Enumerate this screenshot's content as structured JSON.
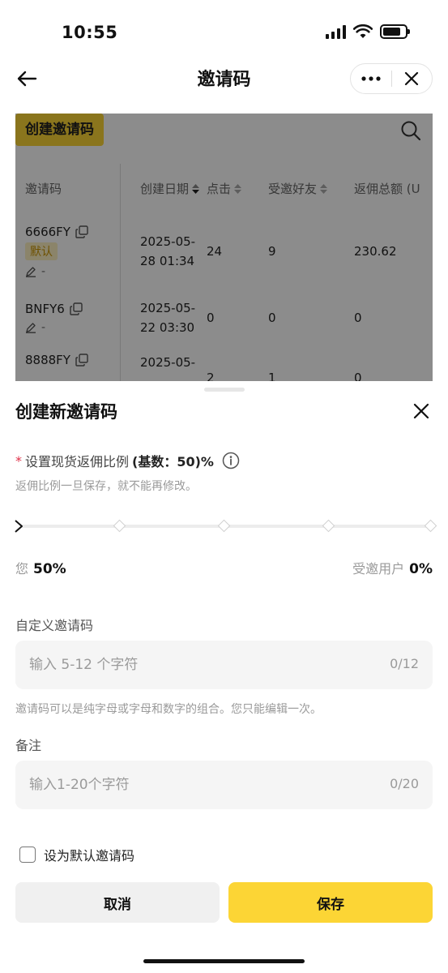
{
  "status_bar": {
    "time": "10:55"
  },
  "nav": {
    "title": "邀请码"
  },
  "background_page": {
    "create_button": "创建邀请码",
    "table": {
      "headers": [
        "邀请码",
        "创建日期",
        "点击",
        "受邀好友",
        "返佣总额 (U"
      ],
      "rows": [
        {
          "code": "6666FY",
          "badge": "默认",
          "note": "-",
          "date_line1": "2025-05-",
          "date_line2": "28 01:34",
          "clicks": "24",
          "friends": "9",
          "rebate": "230.62"
        },
        {
          "code": "BNFY6",
          "badge": "",
          "note": "-",
          "date_line1": "2025-05-",
          "date_line2": "22 03:30",
          "clicks": "0",
          "friends": "0",
          "rebate": "0"
        },
        {
          "code": "8888FY",
          "badge": "",
          "note": "",
          "date_line1": "2025-05-",
          "date_line2": "",
          "clicks": "2",
          "friends": "1",
          "rebate": "0"
        }
      ]
    }
  },
  "sheet": {
    "title": "创建新邀请码",
    "ratio_required_mark": "*",
    "ratio_label": "设置现货返佣比例",
    "ratio_base": "(基数：50)%",
    "ratio_hint": "返佣比例一旦保存，就不能再修改。",
    "slider_value": 0,
    "you_label": "您",
    "you_value": "50%",
    "invitee_label": "受邀用户",
    "invitee_value": "0%",
    "custom_code": {
      "label": "自定义邀请码",
      "placeholder": "输入 5-12 个字符",
      "value": "",
      "counter": "0/12",
      "hint": "邀请码可以是纯字母或字母和数字的组合。您只能编辑一次。"
    },
    "note": {
      "label": "备注",
      "placeholder": "输入1-20个字符",
      "value": "",
      "counter": "0/20"
    },
    "default_checkbox_label": "设为默认邀请码",
    "cancel_button": "取消",
    "save_button": "保存"
  },
  "colors": {
    "accent": "#fcd535",
    "required": "#e0324a"
  }
}
